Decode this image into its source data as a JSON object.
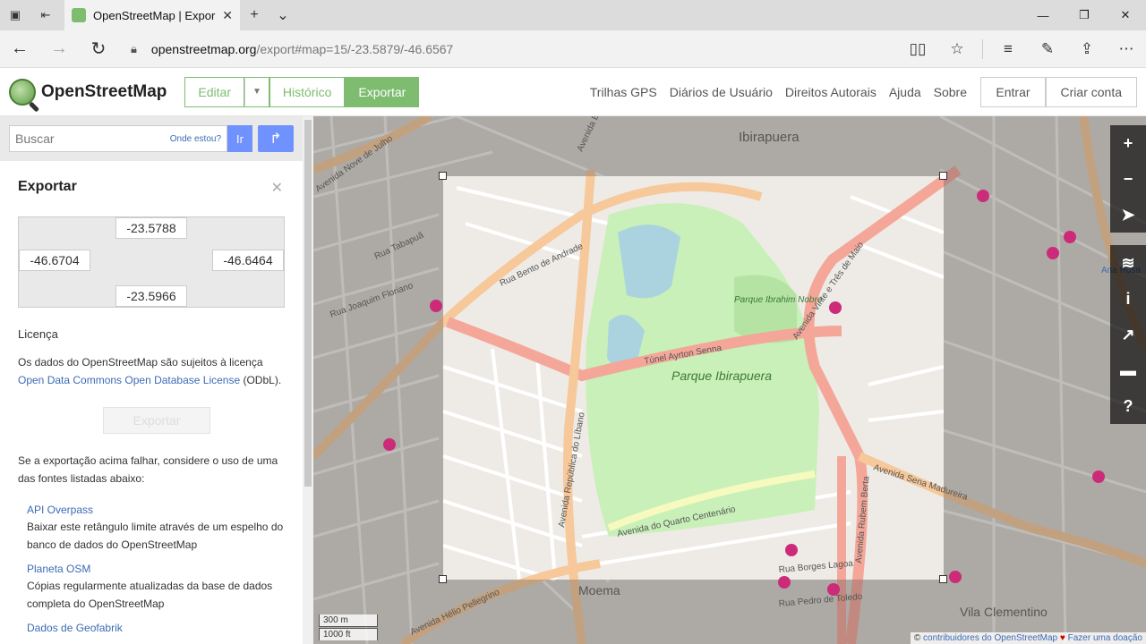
{
  "browser": {
    "tab_title": "OpenStreetMap | Expor",
    "url_host": "openstreetmap.org",
    "url_path": "/export#map=15/-23.5879/-46.6567",
    "icons": [
      "tab-preview-icon",
      "set-aside-icon",
      "back-icon",
      "forward-icon",
      "refresh-icon",
      "lock-icon",
      "reading-view-icon",
      "favorite-star-icon",
      "hub-icon",
      "notes-icon",
      "share-icon",
      "more-icon"
    ]
  },
  "header": {
    "logo_text": "OpenStreetMap",
    "edit_label": "Editar",
    "history_label": "Histórico",
    "export_label": "Exportar",
    "links": [
      "Trilhas GPS",
      "Diários de Usuário",
      "Direitos Autorais",
      "Ajuda",
      "Sobre"
    ],
    "login_label": "Entrar",
    "signup_label": "Criar conta"
  },
  "search": {
    "placeholder": "Buscar",
    "where_label": "Onde estou?",
    "go_label": "Ir"
  },
  "export_panel": {
    "title": "Exportar",
    "north": "-23.5788",
    "west": "-46.6704",
    "east": "-46.6464",
    "south": "-23.5966",
    "license_heading": "Licença",
    "license_text": "Os dados do OpenStreetMap são sujeitos à licença",
    "license_link": "Open Data Commons Open Database License",
    "license_suffix": " (ODbL).",
    "export_button": "Exportar",
    "alt_text": "Se a exportação acima falhar, considere o uso de uma das fontes listadas abaixo:",
    "sources": [
      {
        "name": "API Overpass",
        "desc": "Baixar este retângulo limite através de um espelho do banco de dados do OpenStreetMap"
      },
      {
        "name": "Planeta OSM",
        "desc": "Cópias regularmente atualizadas da base de dados completa do OpenStreetMap"
      },
      {
        "name": "Dados de Geofabrik",
        "desc": ""
      }
    ]
  },
  "map": {
    "labels": {
      "ibirapuera": "Ibirapuera",
      "parque_ibirapuera": "Parque Ibirapuera",
      "parque_ibrahim": "Parque Ibrahim Nobre",
      "moema": "Moema",
      "vila_clementino": "Vila Clementino",
      "ana_rosa": "Ana Rosa",
      "tunel": "Túnel Ayrton Senna",
      "av_rep_libano": "Avenida República do Líbano",
      "av_23_maio": "Avenida Vinte e Três de Maio",
      "av_sena_madureira": "Avenida Sena Madureira",
      "av_quarto_centenario": "Avenida do Quarto Centenário",
      "av_helio_pellegrino": "Avenida Hélio Pellegrino",
      "av_nove_julho": "Avenida Nove de Julho",
      "av_brasil": "Avenida Brasil",
      "rua_joaquim_floriano": "Rua Joaquim Floriano",
      "rua_pedro_toledo": "Rua Pedro de Toledo",
      "rua_borges_lagoa": "Rua Borges Lagoa",
      "rua_bento_andrade": "Rua Bento de Andrade",
      "rua_tabapua": "Rua Tabapuã",
      "rua_rubem_berta": "Avenida Rubem Berta"
    },
    "scale_metric": "300 m",
    "scale_imperial": "1000 ft",
    "attribution_prefix": "© ",
    "attribution_link": "contribuidores do OpenStreetMap",
    "attribution_heart": "♥",
    "attribution_donate": "Fazer uma doação",
    "controls": [
      "zoom-in-icon",
      "zoom-out-icon",
      "locate-icon",
      "layers-icon",
      "info-icon",
      "share-icon",
      "note-icon",
      "help-icon"
    ],
    "control_glyphs": {
      "zoom_in": "+",
      "zoom_out": "−",
      "locate": "➤",
      "layers": "≋",
      "info": "i",
      "share": "↗",
      "note": "▬",
      "help": "?"
    }
  }
}
